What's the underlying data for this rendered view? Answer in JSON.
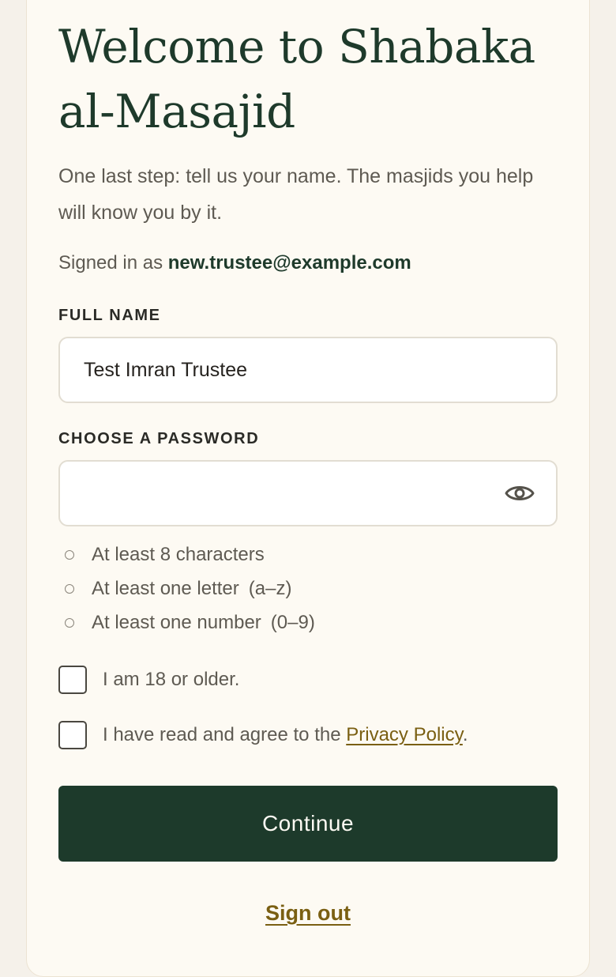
{
  "header": {
    "title": "Welcome to Shabaka al-Masajid",
    "intro": "One last step: tell us your name. The masjids you help will know you by it.",
    "signed_in_prefix": "Signed in as ",
    "signed_in_email": "new.trustee@example.com"
  },
  "form": {
    "full_name_label": "FULL NAME",
    "full_name_value": "Test Imran Trustee",
    "password_label": "CHOOSE A PASSWORD",
    "password_value": "",
    "password_toggle_icon": "eye-icon",
    "rules": [
      "At least 8 characters",
      "At least one letter (a–z)",
      "At least one number (0–9)"
    ],
    "age_check_label": "I am 18 or older.",
    "privacy_prefix": "I have read and agree to the ",
    "privacy_link": "Privacy Policy",
    "privacy_suffix": ".",
    "continue_label": "Continue"
  },
  "footer": {
    "sign_out_label": "Sign out"
  },
  "colors": {
    "page_bg": "#f5f1ea",
    "card_bg": "#fdfaf3",
    "primary": "#1d3a2b",
    "link": "#7a5f12",
    "text_muted": "#5e5a52"
  }
}
